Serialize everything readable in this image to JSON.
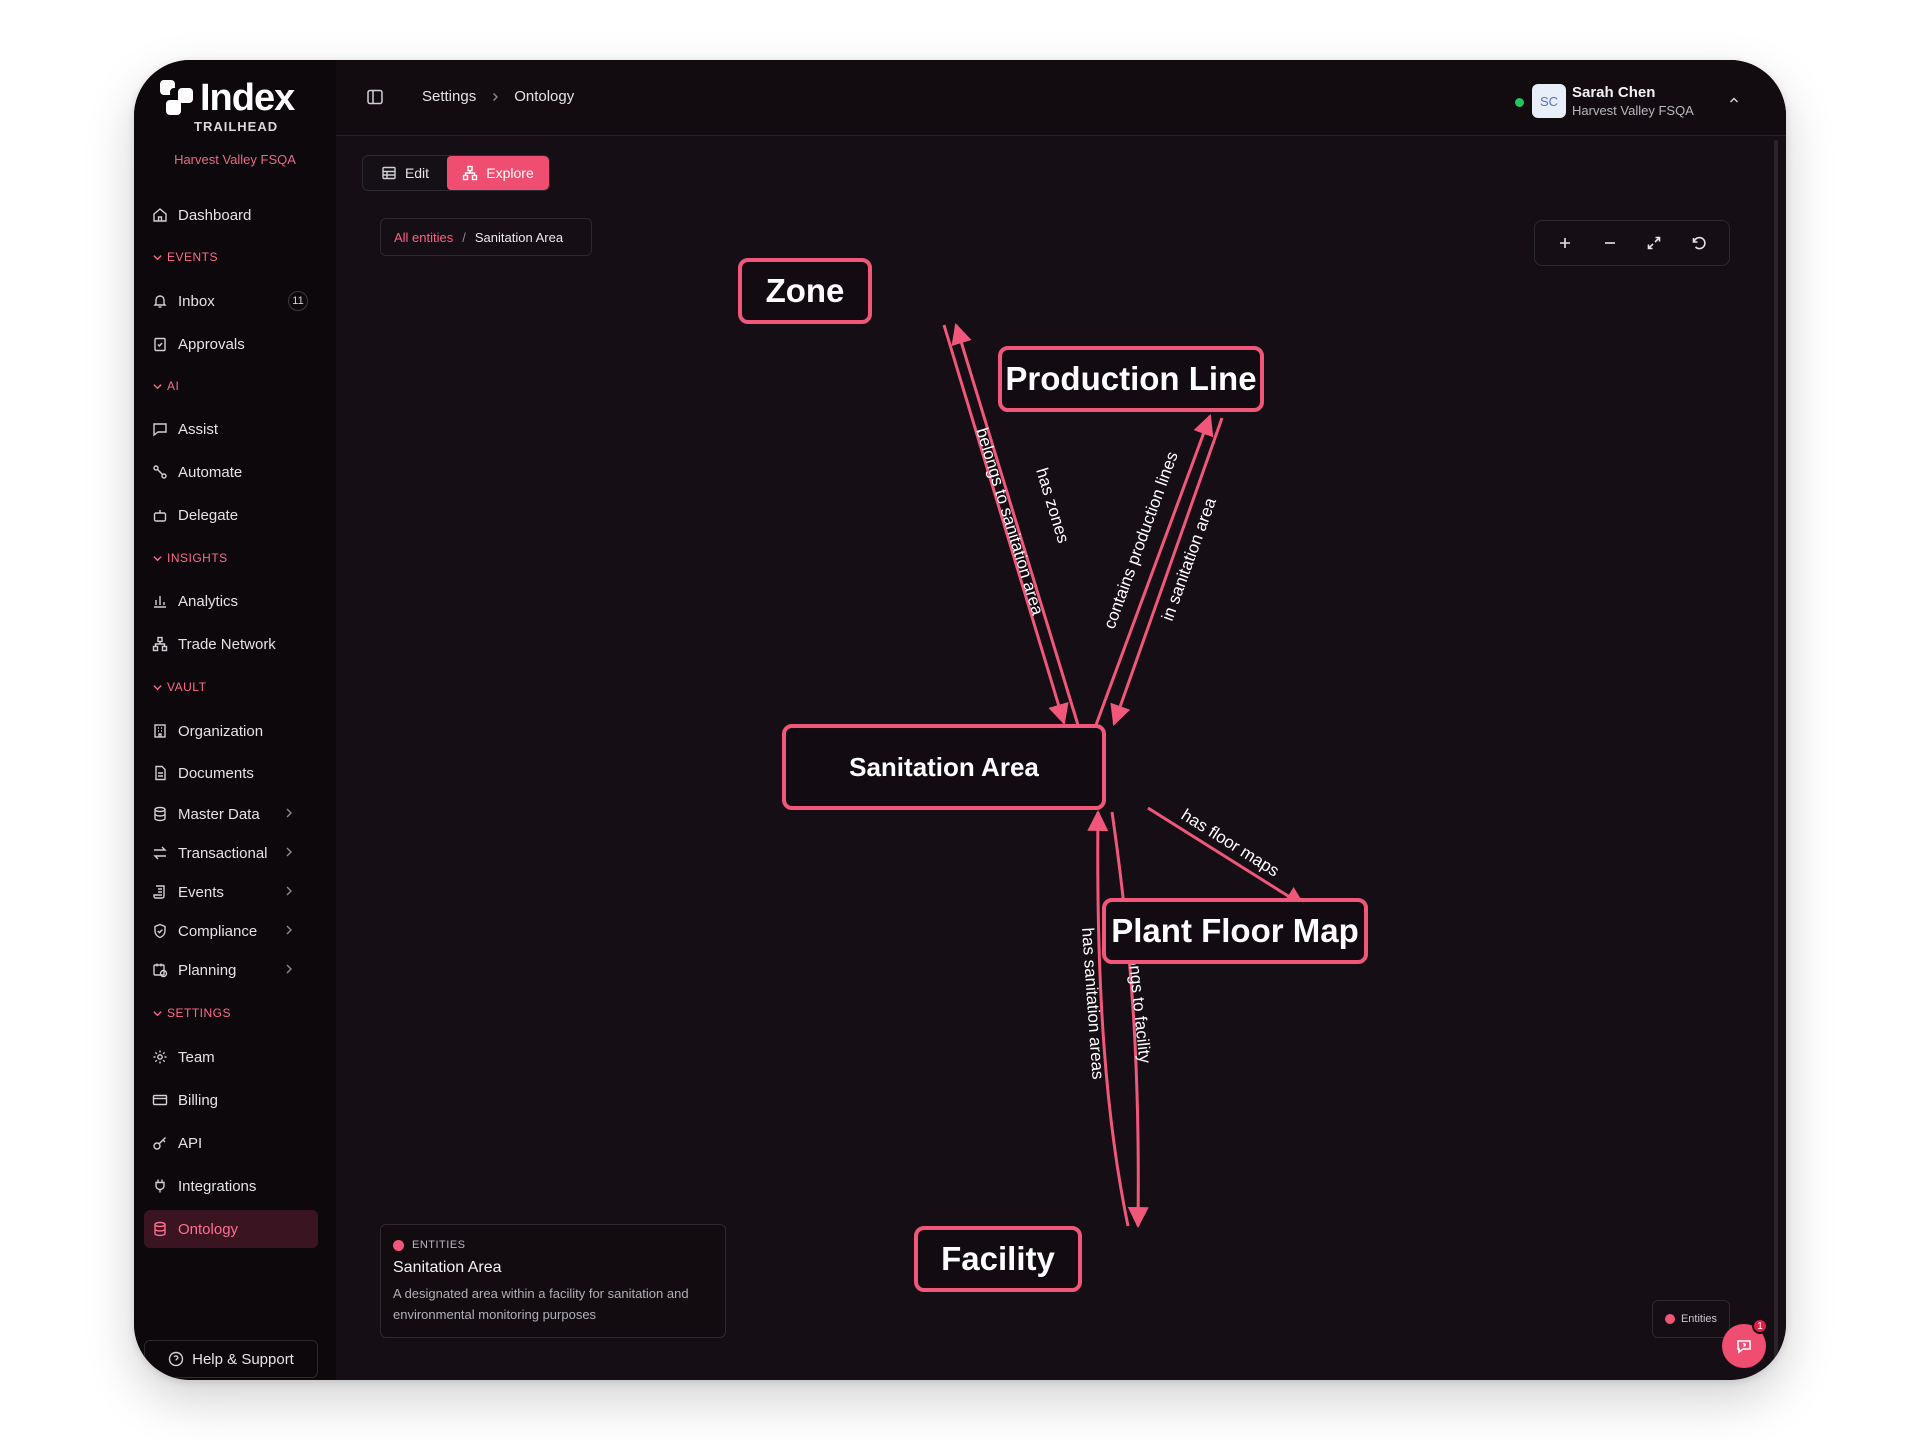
{
  "app": {
    "logo_text": "Index",
    "logo_subtitle": "TRAILHEAD",
    "org_name": "Harvest Valley FSQA"
  },
  "sidebar": {
    "dashboard": "Dashboard",
    "sections": {
      "events": "EVENTS",
      "ai": "AI",
      "insights": "INSIGHTS",
      "vault": "VAULT",
      "settings": "SETTINGS"
    },
    "items": {
      "inbox": "Inbox",
      "inbox_badge": "11",
      "approvals": "Approvals",
      "assist": "Assist",
      "automate": "Automate",
      "delegate": "Delegate",
      "analytics": "Analytics",
      "trade_network": "Trade Network",
      "organization": "Organization",
      "documents": "Documents",
      "master_data": "Master Data",
      "transactional": "Transactional",
      "events": "Events",
      "compliance": "Compliance",
      "planning": "Planning",
      "team": "Team",
      "billing": "Billing",
      "api": "API",
      "integrations": "Integrations",
      "ontology": "Ontology"
    },
    "help": "Help & Support"
  },
  "header": {
    "breadcrumb": [
      "Settings",
      "Ontology"
    ],
    "user": {
      "initials": "SC",
      "name": "Sarah Chen",
      "org": "Harvest Valley FSQA"
    }
  },
  "toolbar": {
    "edit_label": "Edit",
    "explore_label": "Explore"
  },
  "path": {
    "root": "All entities",
    "current": "Sanitation Area"
  },
  "graph": {
    "nodes": {
      "zone": "Zone",
      "production_line": "Production Line",
      "sanitation_area": "Sanitation Area",
      "plant_floor_map": "Plant Floor Map",
      "facility": "Facility"
    },
    "edges": {
      "belongs_to_sanitation_area": "belongs to sanitation area",
      "has_zones": "has zones",
      "contains_production_lines": "contains production lines",
      "in_sanitation_area": "in sanitation area",
      "has_floor_maps": "has floor maps",
      "has_sanitation_areas": "has sanitation areas",
      "belongs_to_facility": "belongs to facility"
    },
    "accent_color": "#f0577a"
  },
  "info_card": {
    "tag": "ENTITIES",
    "title": "Sanitation Area",
    "description": "A designated area within a facility for sanitation and environmental monitoring purposes"
  },
  "legend": {
    "label": "Entities"
  },
  "chat": {
    "badge": "1"
  }
}
